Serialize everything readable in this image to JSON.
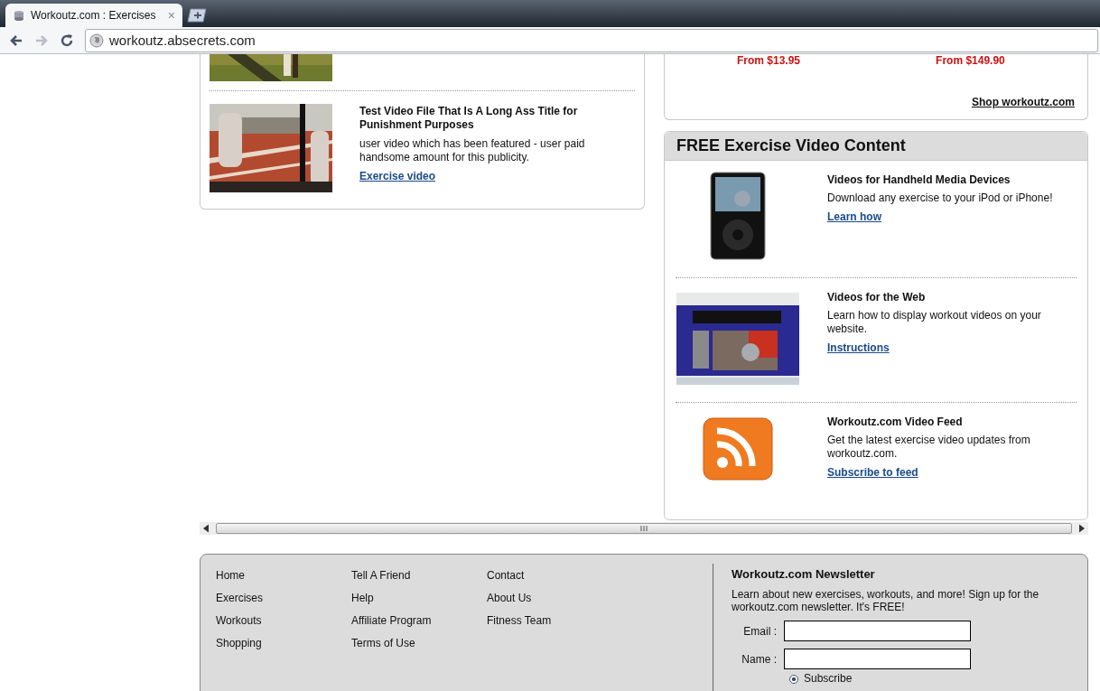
{
  "browser": {
    "tab": {
      "title": "Workoutz.com : Exercises",
      "close": "×"
    },
    "address": "workoutz.absecrets.com"
  },
  "videos": [
    {
      "title": "Test Video File That Is A Long Ass Title for Punishment Purposes",
      "description": "user video which has been featured - user paid handsome amount for this publicity.",
      "link": "Exercise video"
    }
  ],
  "shop": {
    "prices": [
      "From $13.95",
      "From $149.90"
    ],
    "link": "Shop workoutz.com"
  },
  "free_content": {
    "title": "FREE Exercise Video Content",
    "items": [
      {
        "kind": "device",
        "title": "Videos for Handheld Media Devices",
        "description": "Download any exercise to your iPod or iPhone!",
        "link": "Learn how"
      },
      {
        "kind": "web",
        "title": "Videos for the Web",
        "description": "Learn how to display workout videos on your website.",
        "link": "Instructions"
      },
      {
        "kind": "feed",
        "title": "Workoutz.com Video Feed",
        "description": "Get the latest exercise video updates from workoutz.com.",
        "link": "Subscribe to feed"
      }
    ]
  },
  "footer": {
    "link_columns": [
      [
        "Home",
        "Exercises",
        "Workouts",
        "Shopping"
      ],
      [
        "Tell A Friend",
        "Help",
        "Affiliate Program",
        "Terms of Use"
      ],
      [
        "Contact",
        "About Us",
        "Fitness Team"
      ]
    ],
    "newsletter": {
      "title": "Workoutz.com Newsletter",
      "text": "Learn about new exercises, workouts, and more! Sign up for the workoutz.com newsletter. It's FREE!",
      "fields": [
        {
          "label": "Email :"
        },
        {
          "label": "Name :"
        }
      ],
      "options": [
        {
          "label": "Subscribe",
          "selected": true
        }
      ]
    }
  }
}
